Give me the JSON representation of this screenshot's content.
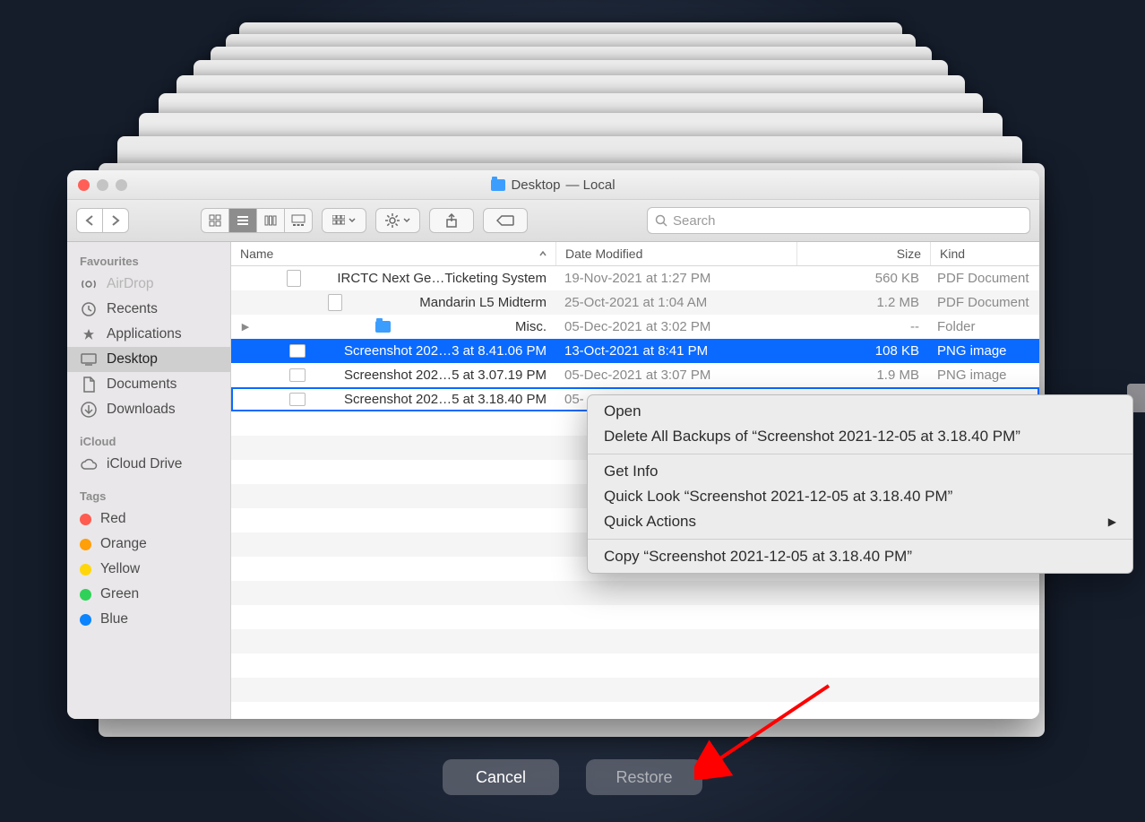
{
  "window": {
    "title_folder": "Desktop",
    "title_suffix": "— Local"
  },
  "toolbar": {
    "search_placeholder": "Search"
  },
  "sidebar": {
    "sections": [
      {
        "title": "Favourites",
        "items": [
          {
            "label": "AirDrop",
            "icon": "airdrop",
            "disabled": true
          },
          {
            "label": "Recents",
            "icon": "recents"
          },
          {
            "label": "Applications",
            "icon": "apps"
          },
          {
            "label": "Desktop",
            "icon": "desktop",
            "selected": true
          },
          {
            "label": "Documents",
            "icon": "documents"
          },
          {
            "label": "Downloads",
            "icon": "downloads"
          }
        ]
      },
      {
        "title": "iCloud",
        "items": [
          {
            "label": "iCloud Drive",
            "icon": "cloud"
          }
        ]
      },
      {
        "title": "Tags",
        "items": [
          {
            "label": "Red",
            "tag": "#ff5b4f"
          },
          {
            "label": "Orange",
            "tag": "#ff9f0a"
          },
          {
            "label": "Yellow",
            "tag": "#ffd60a"
          },
          {
            "label": "Green",
            "tag": "#30d158"
          },
          {
            "label": "Blue",
            "tag": "#0a84ff"
          }
        ]
      }
    ]
  },
  "columns": {
    "name": "Name",
    "date": "Date Modified",
    "size": "Size",
    "kind": "Kind"
  },
  "files": [
    {
      "name": "IRCTC Next Ge…Ticketing System",
      "date": "19-Nov-2021 at 1:27 PM",
      "size": "560 KB",
      "kind": "PDF Document",
      "icon": "doc"
    },
    {
      "name": "Mandarin L5 Midterm",
      "date": "25-Oct-2021 at 1:04 AM",
      "size": "1.2 MB",
      "kind": "PDF Document",
      "icon": "doc"
    },
    {
      "name": "Misc.",
      "date": "05-Dec-2021 at 3:02 PM",
      "size": "--",
      "kind": "Folder",
      "icon": "folder",
      "expandable": true
    },
    {
      "name": "Screenshot 202…3 at 8.41.06 PM",
      "date": "13-Oct-2021 at 8:41 PM",
      "size": "108 KB",
      "kind": "PNG image",
      "icon": "png",
      "selected": true
    },
    {
      "name": "Screenshot 202…5 at 3.07.19 PM",
      "date": "05-Dec-2021 at 3:07 PM",
      "size": "1.9 MB",
      "kind": "PNG image",
      "icon": "png"
    },
    {
      "name": "Screenshot 202…5 at 3.18.40 PM",
      "date": "05-",
      "size": "",
      "kind": "",
      "icon": "png",
      "focused": true
    }
  ],
  "context_menu": {
    "items": [
      {
        "label": "Open"
      },
      {
        "label": "Delete All Backups of “Screenshot 2021-12-05 at 3.18.40 PM”"
      },
      {
        "sep": true
      },
      {
        "label": "Get Info"
      },
      {
        "label": "Quick Look “Screenshot 2021-12-05 at 3.18.40 PM”"
      },
      {
        "label": "Quick Actions",
        "submenu": true
      },
      {
        "sep": true
      },
      {
        "label": "Copy “Screenshot 2021-12-05 at 3.18.40 PM”"
      }
    ]
  },
  "buttons": {
    "cancel": "Cancel",
    "restore": "Restore"
  }
}
